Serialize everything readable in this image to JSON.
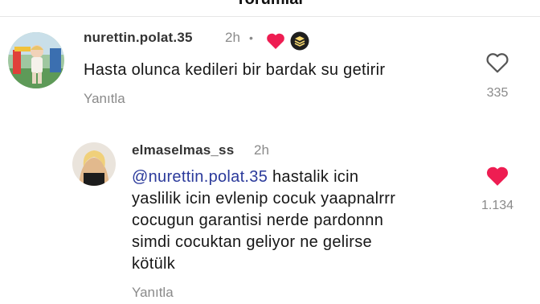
{
  "header": {
    "title": "Yorumlar"
  },
  "comments": [
    {
      "username": "nurettin.polat.35",
      "time": "2h",
      "separator": "•",
      "text": "Hasta olunca kedileri bir bardak su getirir",
      "reply_label": "Yanıtla",
      "likes": "335",
      "liked": false,
      "badges": [
        "creator-heart-icon",
        "stacked-badge-icon"
      ]
    },
    {
      "username": "elmaselmas_ss",
      "time": "2h",
      "mention": "@nurettin.polat.35",
      "text_lines": [
        " hastalik icin",
        "yaslilik icin evlenip cocuk yaapnalrrr",
        "cocugun garantisi nerde pardonnn",
        "simdi cocuktan geliyor ne gelirse",
        "kötülk"
      ],
      "reply_label": "Yanıtla",
      "likes": "1.134",
      "liked": true
    }
  ],
  "colors": {
    "like_red": "#ee1d52",
    "mention": "#2b3a9b",
    "muted": "#8a8a8a"
  }
}
